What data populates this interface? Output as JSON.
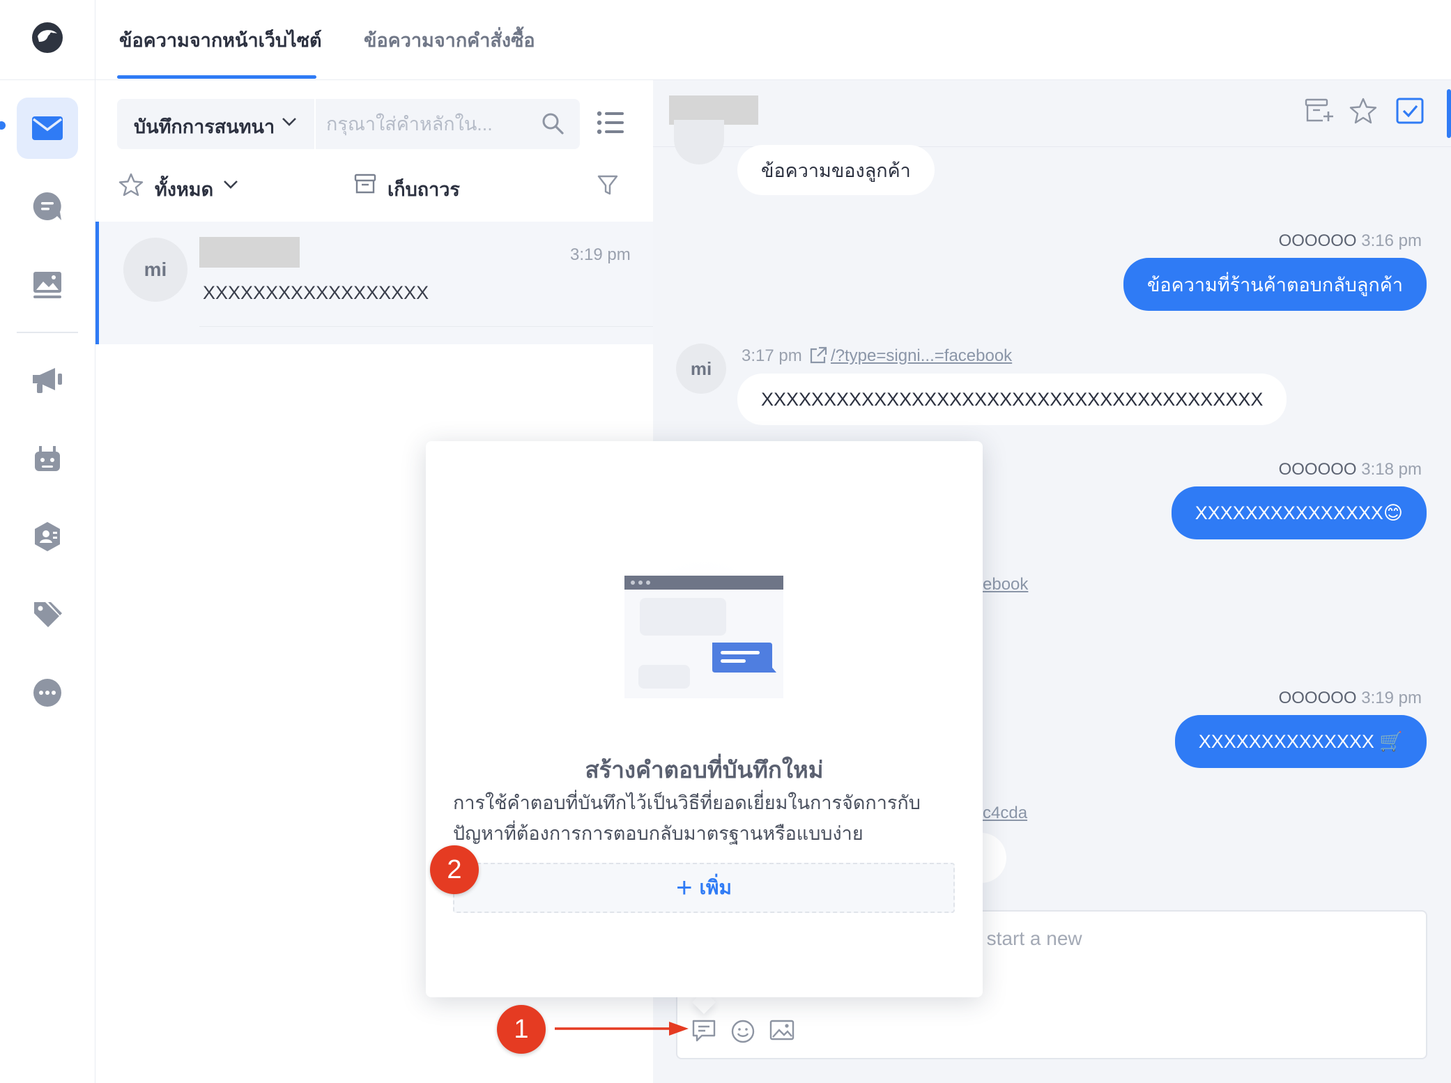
{
  "top_tabs": {
    "items": [
      {
        "label": "ข้อความจากหน้าเว็บไซต์",
        "active": true
      },
      {
        "label": "ข้อความจากคำสั่งซื้อ",
        "active": false
      }
    ]
  },
  "rail": {
    "items": [
      {
        "icon": "mail-icon",
        "active": true
      },
      {
        "icon": "chat-bubble-icon"
      },
      {
        "icon": "image-icon"
      },
      {
        "icon": "megaphone-icon"
      },
      {
        "icon": "robot-icon"
      },
      {
        "icon": "contact-icon"
      },
      {
        "icon": "tags-icon"
      },
      {
        "icon": "more-icon"
      }
    ]
  },
  "list": {
    "filter_dropdown": "บันทึกการสนทนา",
    "search_placeholder": "กรุณาใส่คำหลักใน...",
    "all_filter": "ทั้งหมด",
    "archive_label": "เก็บถาวร",
    "conversation": {
      "avatar_text": "mi",
      "time": "3:19 pm",
      "preview": "XXXXXXXXXXXXXXXXXX"
    }
  },
  "chat": {
    "messages": [
      {
        "direction": "in",
        "text": "ข้อความของลูกค้า"
      },
      {
        "direction": "out",
        "sender": "OOOOOO",
        "time": "3:16 pm",
        "text": "ข้อความที่ร้านค้าตอบกลับลูกค้า"
      },
      {
        "direction": "in",
        "avatar_text": "mi",
        "time": "3:17 pm",
        "link": "/?type=signi...=facebook",
        "text": "XXXXXXXXXXXXXXXXXXXXXXXXXXXXXXXXXXXXXXXX"
      },
      {
        "direction": "out",
        "sender": "OOOOOO",
        "time": "3:18 pm",
        "text": "XXXXXXXXXXXXXXX😊"
      },
      {
        "direction": "in",
        "link": "ebook"
      },
      {
        "direction": "out",
        "sender": "OOOOOO",
        "time": "3:19 pm",
        "text": "XXXXXXXXXXXXXX 🛒"
      },
      {
        "direction": "in",
        "link": "c4cda"
      }
    ],
    "composer_placeholder": "nd message, Press Shift+Enter to start a new"
  },
  "popup": {
    "title": "สร้างคำตอบที่บันทึกใหม่",
    "description_line1": "การใช้คำตอบที่บันทึกไว้เป็นวิธีที่ยอดเยี่ยมในการจัดการกับ",
    "description_line2": "ปัญหาที่ต้องการการตอบกลับมาตรฐานหรือแบบง่าย",
    "add_label": "เพิ่ม",
    "add_icon": "+"
  },
  "annotations": {
    "step1": "1",
    "step2": "2"
  },
  "colors": {
    "accent": "#2f7bf5",
    "annotation": "#e53b22"
  }
}
